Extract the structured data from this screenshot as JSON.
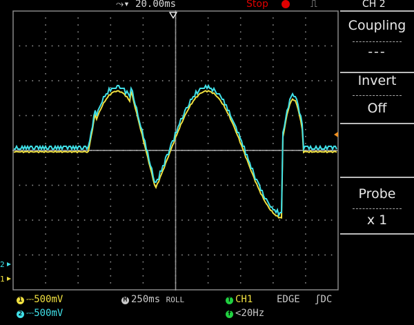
{
  "top_bar": {
    "timebase": "20.00ms",
    "run_state": "Stop",
    "channel": "CH 2"
  },
  "side_menu": {
    "coupling_label": "Coupling",
    "coupling_value": "---",
    "invert_label": "Invert",
    "invert_value": "Off",
    "probe_label": "Probe",
    "probe_value": "x 1"
  },
  "bottom_bar": {
    "ch1_scale": "500mV",
    "ch2_scale": "500mV",
    "main_timebase": "250ms",
    "mode": "ROLL",
    "trigger_source": "CH1",
    "trigger_type": "EDGE",
    "trigger_coupling": "DC",
    "trigger_freq": "<20Hz",
    "ch1_marker": "1",
    "ch2_marker": "2",
    "m_marker": "M",
    "t_marker": "T",
    "f_marker": "f"
  },
  "colors": {
    "ch1": "#f0e040",
    "ch2": "#40e0e8",
    "stop": "#e00000",
    "trigger": "#20d040"
  }
}
